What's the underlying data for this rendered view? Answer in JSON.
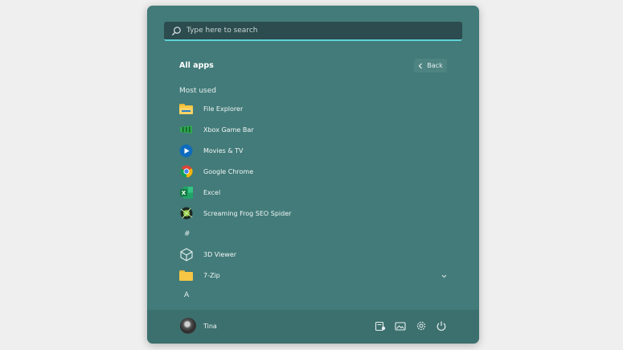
{
  "search": {
    "placeholder": "Type here to search"
  },
  "header": {
    "title": "All apps",
    "back_label": "Back"
  },
  "sections": {
    "most_used": "Most used",
    "hash": "#",
    "a": "A"
  },
  "most_used_apps": [
    {
      "label": "File Explorer",
      "icon": "file-explorer-icon"
    },
    {
      "label": "Xbox Game Bar",
      "icon": "xbox-game-bar-icon"
    },
    {
      "label": "Movies & TV",
      "icon": "movies-tv-icon"
    },
    {
      "label": "Google Chrome",
      "icon": "chrome-icon"
    },
    {
      "label": "Excel",
      "icon": "excel-icon"
    },
    {
      "label": "Screaming Frog SEO Spider",
      "icon": "screaming-frog-icon"
    }
  ],
  "hash_apps": [
    {
      "label": "3D Viewer",
      "icon": "3d-viewer-icon"
    },
    {
      "label": "7-Zip",
      "icon": "folder-icon"
    }
  ],
  "footer": {
    "user_name": "Tina",
    "icons": [
      "documents-icon",
      "pictures-folder-icon",
      "settings-icon",
      "power-icon"
    ]
  },
  "colors": {
    "panel": "#427b79",
    "accent": "#5fd3d6",
    "footer": "#3c706e"
  }
}
